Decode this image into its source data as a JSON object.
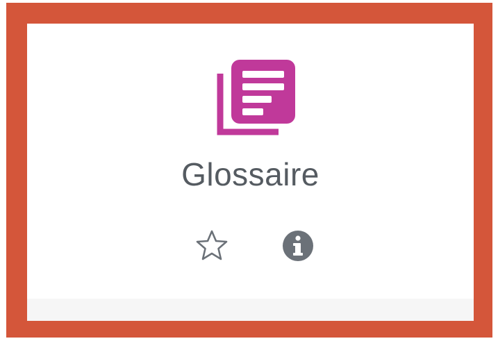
{
  "module": {
    "name": "Glossaire",
    "icon": "glossary-icon",
    "accent_color": "#c0399a"
  },
  "actions": {
    "star_icon": "star-outline-icon",
    "info_icon": "info-circle-icon",
    "star_glyph": "☆",
    "info_glyph": "i"
  },
  "colors": {
    "frame": "#d4563a",
    "card": "#ffffff",
    "text": "#555b61",
    "icon_grey": "#6b7178"
  }
}
